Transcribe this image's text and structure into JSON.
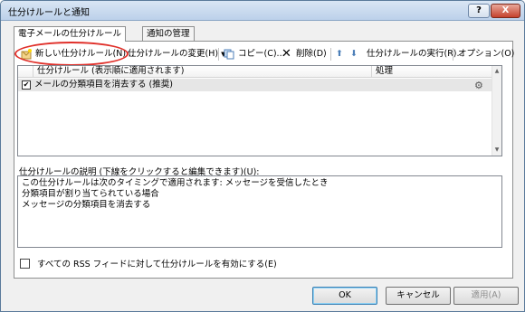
{
  "window": {
    "title": "仕分けルールと通知",
    "help_label": "?",
    "close_label": "X"
  },
  "tabs": [
    {
      "label": "電子メールの仕分けルール"
    },
    {
      "label": "通知の管理"
    }
  ],
  "toolbar": {
    "new_rule": "新しい仕分けルール(N)...",
    "change_rule": "仕分けルールの変更(H)",
    "copy": "コピー(C)...",
    "delete": "削除(D)",
    "run_rules": "仕分けルールの実行(R)...",
    "options": "オプション(O)"
  },
  "list": {
    "col_rule": "仕分けルール (表示順に適用されます)",
    "col_action": "処理",
    "rows": [
      {
        "label": "メールの分類項目を消去する (推奨)",
        "checked": true
      }
    ]
  },
  "description": {
    "label": "仕分けルールの説明 (下線をクリックすると編集できます)(U):",
    "lines": [
      "この仕分けルールは次のタイミングで適用されます: メッセージを受信したとき",
      "分類項目が割り当てられている場合",
      "メッセージの分類項目を消去する"
    ]
  },
  "enable_rss": "すべての RSS フィードに対して仕分けルールを有効にする(E)",
  "buttons": {
    "ok": "OK",
    "cancel": "キャンセル",
    "apply": "適用(A)"
  }
}
